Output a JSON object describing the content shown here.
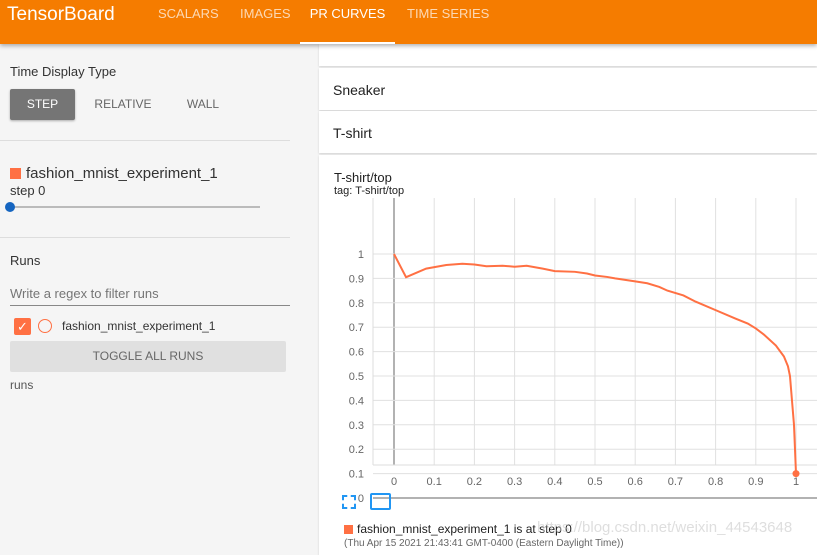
{
  "header": {
    "brand": "TensorBoard",
    "tabs": [
      {
        "label": "SCALARS"
      },
      {
        "label": "IMAGES"
      },
      {
        "label": "PR CURVES",
        "active": true
      },
      {
        "label": "TIME SERIES"
      }
    ],
    "color": "#f57c00"
  },
  "sidebar": {
    "time_display_label": "Time Display Type",
    "time_options": [
      "STEP",
      "RELATIVE",
      "WALL"
    ],
    "selected_time_option": "STEP",
    "run_step": {
      "run": "fashion_mnist_experiment_1",
      "step_label": "step 0",
      "slider_value": 0,
      "color": "#ff7043"
    },
    "runs_label": "Runs",
    "filter_placeholder": "Write a regex to filter runs",
    "runs": [
      {
        "name": "fashion_mnist_experiment_1",
        "checked": true
      }
    ],
    "toggle_all": "TOGGLE ALL RUNS",
    "footer": "runs"
  },
  "main": {
    "categories": [
      "Sneaker",
      "T-shirt"
    ],
    "card": {
      "title": "T-shirt/top",
      "tag": "tag: T-shirt/top",
      "legend": "fashion_mnist_experiment_1 is at step 0",
      "timestamp": "(Thu Apr 15 2021 21:43:41 GMT-0400 (Eastern Daylight Time))"
    }
  },
  "watermark": "https://blog.csdn.net/weixin_44543648",
  "chart_data": {
    "type": "line",
    "title": "T-shirt/top",
    "xlabel": "",
    "ylabel": "",
    "xlim": [
      -0.05,
      1.05
    ],
    "ylim": [
      -0.05,
      1.05
    ],
    "grid": true,
    "xticks": [
      "0",
      "0.1",
      "0.2",
      "0.3",
      "0.4",
      "0.5",
      "0.6",
      "0.7",
      "0.8",
      "0.9",
      "1"
    ],
    "yticks": [
      "0",
      "0.1",
      "0.2",
      "0.3",
      "0.4",
      "0.5",
      "0.6",
      "0.7",
      "0.8",
      "0.9",
      "1"
    ],
    "series": [
      {
        "name": "fashion_mnist_experiment_1",
        "color": "#ff7043",
        "x": [
          0,
          0.03,
          0.08,
          0.13,
          0.17,
          0.2,
          0.23,
          0.27,
          0.3,
          0.33,
          0.37,
          0.4,
          0.45,
          0.48,
          0.5,
          0.53,
          0.55,
          0.6,
          0.63,
          0.66,
          0.68,
          0.72,
          0.75,
          0.8,
          0.85,
          0.88,
          0.9,
          0.92,
          0.95,
          0.97,
          0.98,
          0.985,
          0.99,
          0.995,
          1
        ],
        "y": [
          1,
          0.905,
          0.94,
          0.955,
          0.96,
          0.957,
          0.95,
          0.952,
          0.948,
          0.952,
          0.94,
          0.93,
          0.927,
          0.92,
          0.912,
          0.906,
          0.9,
          0.888,
          0.88,
          0.865,
          0.85,
          0.83,
          0.805,
          0.77,
          0.735,
          0.715,
          0.695,
          0.67,
          0.625,
          0.58,
          0.54,
          0.5,
          0.4,
          0.3,
          0.1
        ]
      }
    ]
  }
}
